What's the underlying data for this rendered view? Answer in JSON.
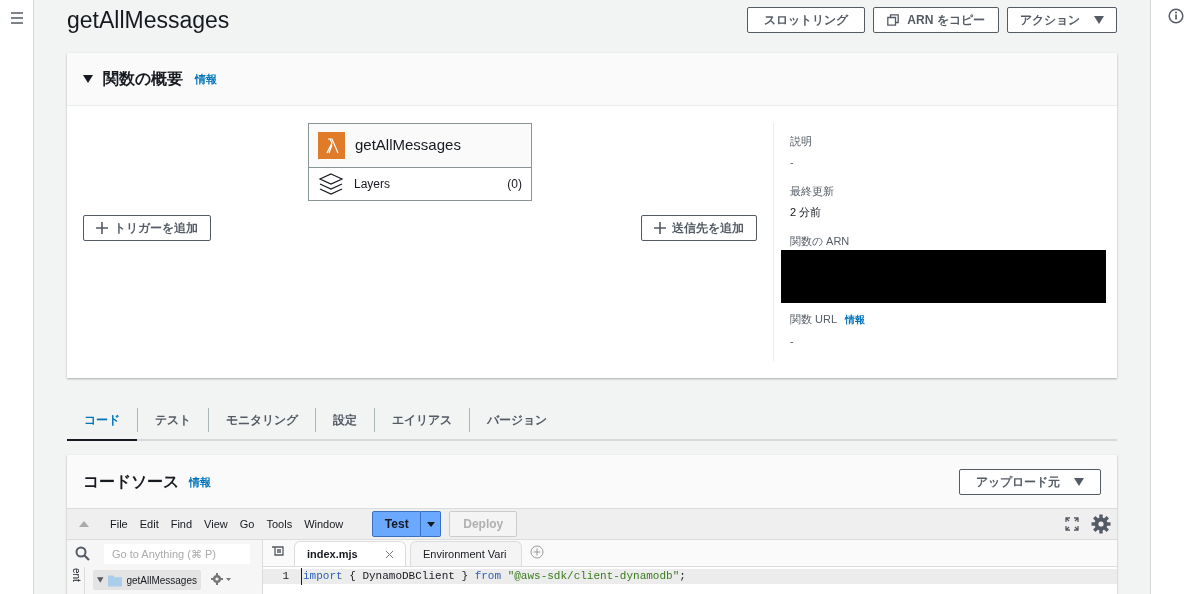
{
  "page": {
    "title": "getAllMessages"
  },
  "header_buttons": [
    {
      "label": "スロットリング",
      "kind": "plain"
    },
    {
      "label": "ARN をコピー",
      "kind": "copy"
    },
    {
      "label": "アクション",
      "kind": "dropdown"
    }
  ],
  "overview": {
    "title": "関数の概要",
    "expanded": true,
    "info_link": "情報",
    "function": {
      "name": "getAllMessages",
      "layers_label": "Layers",
      "layers_count": "(0)"
    },
    "add_trigger": "トリガーを追加",
    "add_destination": "送信先を追加",
    "details": [
      {
        "label": "説明",
        "kind": "text",
        "value": "-"
      },
      {
        "label": "最終更新",
        "kind": "text",
        "value": "2 分前"
      },
      {
        "label": "関数の ARN",
        "kind": "redacted"
      },
      {
        "label": "関数 URL",
        "kind": "text",
        "info_link": "情報",
        "value": "-"
      }
    ]
  },
  "tabs": [
    {
      "label": "コード",
      "selected": true
    },
    {
      "label": "テスト",
      "selected": false
    },
    {
      "label": "モニタリング",
      "selected": false
    },
    {
      "label": "設定",
      "selected": false
    },
    {
      "label": "エイリアス",
      "selected": false
    },
    {
      "label": "バージョン",
      "selected": false
    }
  ],
  "code_source": {
    "title": "コードソース",
    "info_link": "情報",
    "upload_button": "アップロード元",
    "menu": [
      "File",
      "Edit",
      "Find",
      "View",
      "Go",
      "Tools",
      "Window"
    ],
    "test_button": "Test",
    "deploy_button": {
      "label": "Deploy",
      "disabled": true
    },
    "search": {
      "placeholder": "Go to Anything (⌘ P)"
    },
    "side_tab": "ent",
    "tree": [
      {
        "name": "getAllMessages",
        "expanded": true
      }
    ],
    "editor_tabs": [
      {
        "label": "index.mjs",
        "selected": true
      },
      {
        "label": "Environment Vari",
        "selected": false
      }
    ],
    "code_lines": [
      {
        "number": "1",
        "tokens": [
          {
            "text": "import",
            "kind": "keyword"
          },
          {
            "text": " { DynamoDBClient } ",
            "kind": "plain"
          },
          {
            "text": "from",
            "kind": "keyword"
          },
          {
            "text": " \"@aws-sdk/client-dynamodb\"",
            "kind": "string"
          },
          {
            "text": ";",
            "kind": "plain"
          }
        ]
      }
    ]
  }
}
